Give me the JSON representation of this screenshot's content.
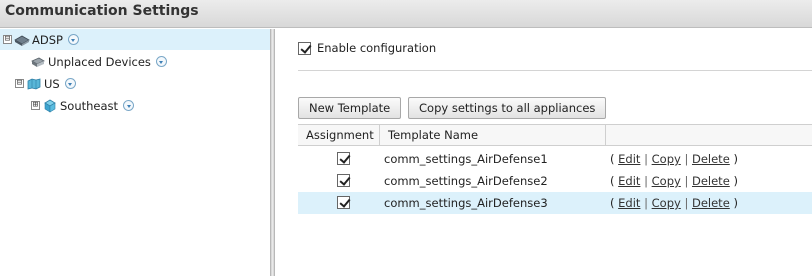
{
  "page": {
    "title": "Communication Settings"
  },
  "tree": {
    "items": [
      {
        "label": "ADSP",
        "expander": "⊟",
        "icon": "network-icon",
        "selected": true
      },
      {
        "label": "Unplaced Devices",
        "expander": "",
        "icon": "device-icon",
        "selected": false
      },
      {
        "label": "US",
        "expander": "⊟",
        "icon": "country-icon",
        "selected": false
      },
      {
        "label": "Southeast",
        "expander": "⊞",
        "icon": "region-icon",
        "selected": false
      }
    ]
  },
  "config": {
    "enable_label": "Enable configuration",
    "enable_checked": true
  },
  "toolbar": {
    "new_template_label": "New Template",
    "copy_settings_label": "Copy settings to all appliances"
  },
  "table": {
    "columns": [
      "Assignment",
      "Template Name"
    ],
    "rows": [
      {
        "assigned": true,
        "name": "comm_settings_AirDefense1",
        "selected": false
      },
      {
        "assigned": true,
        "name": "comm_settings_AirDefense2",
        "selected": false
      },
      {
        "assigned": true,
        "name": "comm_settings_AirDefense3",
        "selected": true
      }
    ],
    "actions": {
      "open": "(",
      "edit": "Edit",
      "sep": "|",
      "copy": "Copy",
      "delete": "Delete",
      "close": ")"
    }
  },
  "colors": {
    "selection": "#dcf1fb",
    "menu_arrow": "#3d7fb5"
  }
}
